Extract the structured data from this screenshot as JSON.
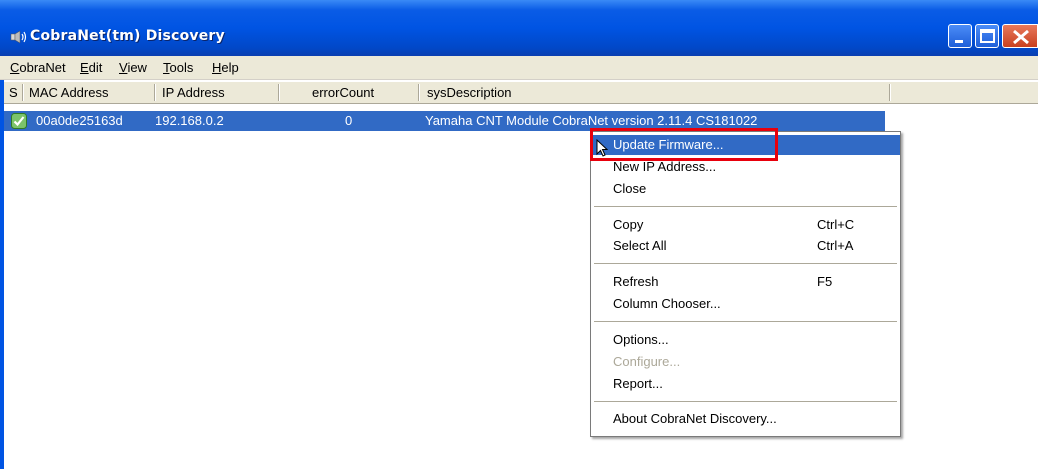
{
  "window": {
    "title": "CobraNet(tm) Discovery",
    "icon": "speaker-icon"
  },
  "menubar": [
    {
      "label": "CobraNet"
    },
    {
      "label": "Edit"
    },
    {
      "label": "View"
    },
    {
      "label": "Tools"
    },
    {
      "label": "Help"
    }
  ],
  "table": {
    "columns": [
      "S",
      "MAC Address",
      "IP Address",
      "errorCount",
      "sysDescription"
    ],
    "rows": [
      {
        "status": "check-icon",
        "mac": "00a0de25163d",
        "ip": "192.168.0.2",
        "errorCount": "0",
        "sysDescription": "Yamaha CNT Module CobraNet version 2.11.4 CS181022"
      }
    ]
  },
  "context_menu": {
    "items": [
      {
        "label": "Update Firmware...",
        "highlighted": true
      },
      {
        "label": "New IP Address..."
      },
      {
        "label": "Close"
      },
      {
        "label": "Copy",
        "shortcut": "Ctrl+C"
      },
      {
        "label": "Select All",
        "shortcut": "Ctrl+A"
      },
      {
        "label": "Refresh",
        "shortcut": "F5"
      },
      {
        "label": "Column Chooser..."
      },
      {
        "label": "Options..."
      },
      {
        "label": "Configure...",
        "disabled": true
      },
      {
        "label": "Report..."
      },
      {
        "label": "About CobraNet Discovery..."
      }
    ]
  },
  "colors": {
    "titlebar": "#0054e3",
    "selection": "#316ac5",
    "highlight_box": "#e8000c"
  }
}
